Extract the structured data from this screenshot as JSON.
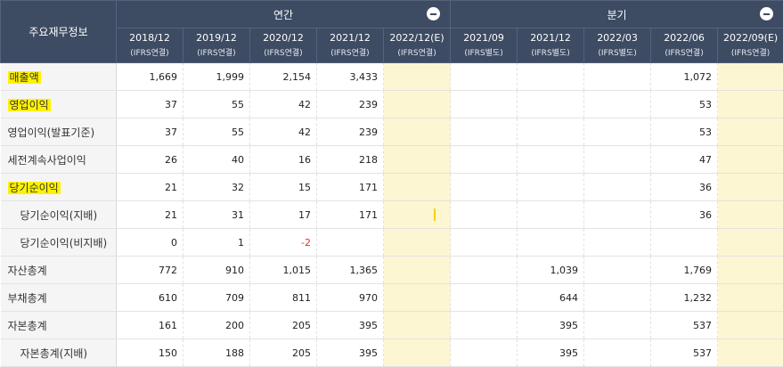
{
  "header": {
    "corner_label": "주요재무정보",
    "annual_label": "연간",
    "quarter_label": "분기",
    "annual_columns": [
      {
        "date": "2018/12",
        "std": "(IFRS연결)",
        "estimate": false
      },
      {
        "date": "2019/12",
        "std": "(IFRS연결)",
        "estimate": false
      },
      {
        "date": "2020/12",
        "std": "(IFRS연결)",
        "estimate": false
      },
      {
        "date": "2021/12",
        "std": "(IFRS연결)",
        "estimate": false
      },
      {
        "date": "2022/12(E)",
        "std": "(IFRS연결)",
        "estimate": true
      }
    ],
    "quarter_columns": [
      {
        "date": "2021/09",
        "std": "(IFRS별도)",
        "estimate": false
      },
      {
        "date": "2021/12",
        "std": "(IFRS별도)",
        "estimate": false
      },
      {
        "date": "2022/03",
        "std": "(IFRS별도)",
        "estimate": false
      },
      {
        "date": "2022/06",
        "std": "(IFRS연결)",
        "estimate": false
      },
      {
        "date": "2022/09(E)",
        "std": "(IFRS연결)",
        "estimate": true
      }
    ]
  },
  "rows": [
    {
      "label": "매출액",
      "highlight": true,
      "sub": false,
      "annual": [
        "1,669",
        "1,999",
        "2,154",
        "3,433",
        ""
      ],
      "quarter": [
        "",
        "",
        "",
        "1,072",
        ""
      ]
    },
    {
      "label": "영업이익",
      "highlight": true,
      "sub": false,
      "annual": [
        "37",
        "55",
        "42",
        "239",
        ""
      ],
      "quarter": [
        "",
        "",
        "",
        "53",
        ""
      ]
    },
    {
      "label": "영업이익(발표기준)",
      "highlight": false,
      "sub": false,
      "annual": [
        "37",
        "55",
        "42",
        "239",
        ""
      ],
      "quarter": [
        "",
        "",
        "",
        "53",
        ""
      ]
    },
    {
      "label": "세전계속사업이익",
      "highlight": false,
      "sub": false,
      "annual": [
        "26",
        "40",
        "16",
        "218",
        ""
      ],
      "quarter": [
        "",
        "",
        "",
        "47",
        ""
      ]
    },
    {
      "label": "당기순이익",
      "highlight": true,
      "sub": false,
      "annual": [
        "21",
        "32",
        "15",
        "171",
        ""
      ],
      "quarter": [
        "",
        "",
        "",
        "36",
        ""
      ]
    },
    {
      "label": "당기순이익(지배)",
      "highlight": false,
      "sub": true,
      "caret": true,
      "annual": [
        "21",
        "31",
        "17",
        "171",
        ""
      ],
      "quarter": [
        "",
        "",
        "",
        "36",
        ""
      ]
    },
    {
      "label": "당기순이익(비지배)",
      "highlight": false,
      "sub": true,
      "annual": [
        "0",
        "1",
        "-2",
        "",
        ""
      ],
      "quarter": [
        "",
        "",
        "",
        "",
        ""
      ]
    },
    {
      "label": "자산총계",
      "highlight": false,
      "sub": false,
      "annual": [
        "772",
        "910",
        "1,015",
        "1,365",
        ""
      ],
      "quarter": [
        "",
        "1,039",
        "",
        "1,769",
        ""
      ]
    },
    {
      "label": "부채총계",
      "highlight": false,
      "sub": false,
      "annual": [
        "610",
        "709",
        "811",
        "970",
        ""
      ],
      "quarter": [
        "",
        "644",
        "",
        "1,232",
        ""
      ]
    },
    {
      "label": "자본총계",
      "highlight": false,
      "sub": false,
      "annual": [
        "161",
        "200",
        "205",
        "395",
        ""
      ],
      "quarter": [
        "",
        "395",
        "",
        "537",
        ""
      ]
    },
    {
      "label": "자본총계(지배)",
      "highlight": false,
      "sub": true,
      "annual": [
        "150",
        "188",
        "205",
        "395",
        ""
      ],
      "quarter": [
        "",
        "395",
        "",
        "537",
        ""
      ]
    }
  ],
  "colors": {
    "header_bg": "#3d4b63",
    "estimate_bg": "#fdf6d3",
    "highlight": "#fff200",
    "negative": "#e03030"
  },
  "icons": {
    "collapse": "minus-circle-icon"
  }
}
